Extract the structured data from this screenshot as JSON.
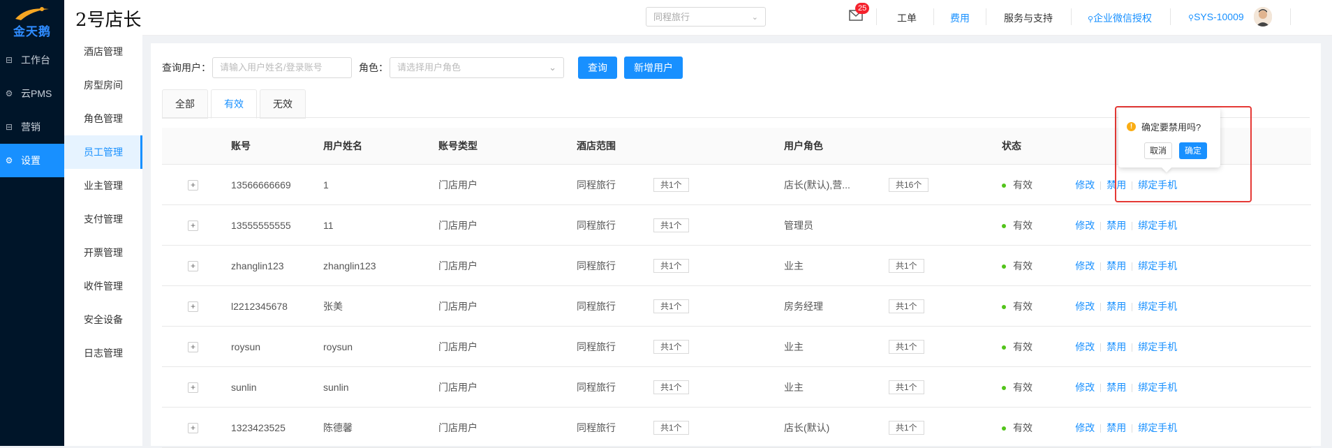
{
  "logo": {
    "text": "金天鹅"
  },
  "nav": [
    {
      "label": "工作台",
      "icon": "workbench-icon"
    },
    {
      "label": "云PMS",
      "icon": "gear-icon"
    },
    {
      "label": "营销",
      "icon": "marketing-icon"
    },
    {
      "label": "设置",
      "icon": "gear-icon",
      "active": true
    }
  ],
  "header": {
    "store_title": "2号店长",
    "hotel_select": "同程旅行",
    "mail_badge": "25",
    "links": {
      "ticket": "工单",
      "fee": "费用",
      "support": "服务与支持",
      "wechat": "企业微信授权",
      "account": "SYS-10009"
    }
  },
  "submenu": [
    {
      "label": "酒店管理"
    },
    {
      "label": "房型房间"
    },
    {
      "label": "角色管理"
    },
    {
      "label": "员工管理",
      "active": true
    },
    {
      "label": "业主管理"
    },
    {
      "label": "支付管理"
    },
    {
      "label": "开票管理"
    },
    {
      "label": "收件管理"
    },
    {
      "label": "安全设备"
    },
    {
      "label": "日志管理"
    }
  ],
  "filter": {
    "user_label": "查询用户：",
    "user_placeholder": "请输入用户姓名/登录账号",
    "role_label": "角色：",
    "role_placeholder": "请选择用户角色",
    "search_btn": "查询",
    "add_btn": "新增用户"
  },
  "tabs": [
    {
      "label": "全部"
    },
    {
      "label": "有效",
      "active": true
    },
    {
      "label": "无效"
    }
  ],
  "table": {
    "columns": [
      "账号",
      "用户姓名",
      "账号类型",
      "酒店范围",
      "用户角色",
      "状态"
    ],
    "rows": [
      {
        "account": "13566666669",
        "name": "1",
        "type": "门店用户",
        "hotel": "同程旅行",
        "hotel_count": "共1个",
        "role": "店长(默认),营...",
        "role_count": "共16个",
        "status": "有效"
      },
      {
        "account": "13555555555",
        "name": "11",
        "type": "门店用户",
        "hotel": "同程旅行",
        "hotel_count": "共1个",
        "role": "管理员",
        "role_count": "",
        "status": "有效"
      },
      {
        "account": "zhanglin123",
        "name": "zhanglin123",
        "type": "门店用户",
        "hotel": "同程旅行",
        "hotel_count": "共1个",
        "role": "业主",
        "role_count": "共1个",
        "status": "有效"
      },
      {
        "account": "l2212345678",
        "name": "张美",
        "type": "门店用户",
        "hotel": "同程旅行",
        "hotel_count": "共1个",
        "role": "房务经理",
        "role_count": "共1个",
        "status": "有效"
      },
      {
        "account": "roysun",
        "name": "roysun",
        "type": "门店用户",
        "hotel": "同程旅行",
        "hotel_count": "共1个",
        "role": "业主",
        "role_count": "共1个",
        "status": "有效"
      },
      {
        "account": "sunlin",
        "name": "sunlin",
        "type": "门店用户",
        "hotel": "同程旅行",
        "hotel_count": "共1个",
        "role": "业主",
        "role_count": "共1个",
        "status": "有效"
      },
      {
        "account": "1323423525",
        "name": "陈德馨",
        "type": "门店用户",
        "hotel": "同程旅行",
        "hotel_count": "共1个",
        "role": "店长(默认)",
        "role_count": "共1个",
        "status": "有效"
      }
    ],
    "actions": {
      "edit": "修改",
      "disable": "禁用",
      "bind": "绑定手机"
    }
  },
  "popconfirm": {
    "message": "确定要禁用吗?",
    "cancel": "取消",
    "ok": "确定"
  },
  "colors": {
    "primary": "#1890ff",
    "sidebar": "#001529",
    "success": "#52c41a",
    "warning": "#faad14",
    "highlight": "#e53935"
  }
}
